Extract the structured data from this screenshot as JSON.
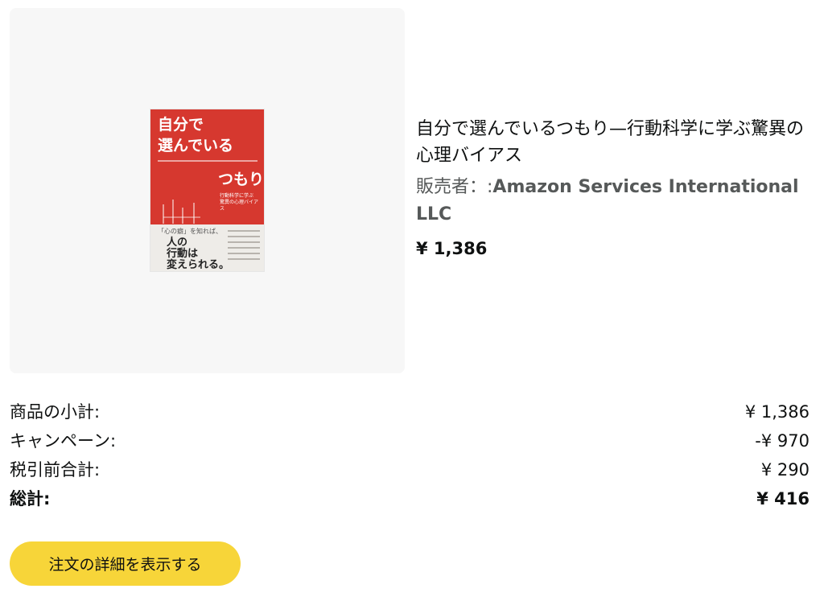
{
  "product": {
    "title": "自分で選んでいるつもり—行動科学に学ぶ驚異の心理バイアス",
    "seller_label": "販売者：:",
    "seller_name": "Amazon Services International LLC",
    "price": "¥ 1,386",
    "cover": {
      "title_line1": "自分で",
      "title_line2": "選んでいる",
      "title_line3": "つもり",
      "subtitle_line1": "行動科学に学ぶ",
      "subtitle_line2": "驚異の心理バイアス",
      "catch_line1": "「心の癖」を知れば、",
      "catch_line2": "人の",
      "catch_line3": "行動は",
      "catch_line4": "変えられる。",
      "colors": {
        "red": "#d6382f",
        "cream": "#eeece8"
      }
    }
  },
  "summary": {
    "rows": [
      {
        "label": "商品の小計:",
        "value": "¥ 1,386"
      },
      {
        "label": "キャンペーン:",
        "value": "-¥ 970"
      },
      {
        "label": "税引前合計:",
        "value": "¥ 290"
      }
    ],
    "total": {
      "label": "総計:",
      "value": "¥ 416"
    }
  },
  "actions": {
    "detail_button_label": "注文の詳細を表示する",
    "button_color": "#f7d539"
  }
}
